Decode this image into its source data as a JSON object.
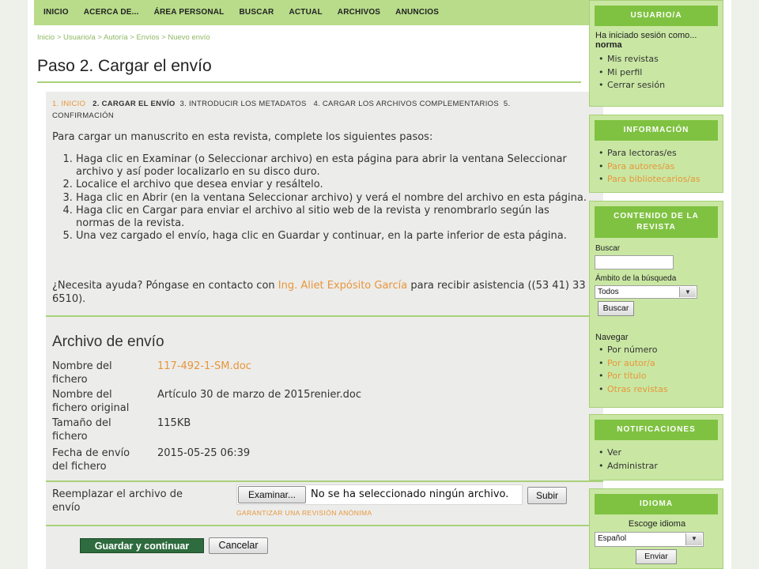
{
  "nav": [
    "INICIO",
    "ACERCA DE...",
    "ÁREA PERSONAL",
    "BUSCAR",
    "ACTUAL",
    "ARCHIVOS",
    "ANUNCIOS"
  ],
  "breadcrumb": [
    "Inicio",
    "Usuario/a",
    "Autoría",
    "Envíos",
    "Nuevo envío"
  ],
  "breadcrumb_sep": " > ",
  "page_title": "Paso 2. Cargar el envío",
  "steps": {
    "s1": "1. INICIO",
    "s2": "2. CARGAR EL ENVÍO",
    "s3": "3. INTRODUCIR LOS METADATOS",
    "s4": "4. CARGAR LOS ARCHIVOS COMPLEMENTARIOS",
    "s5": "5. CONFIRMACIÓN"
  },
  "intro": "Para cargar un manuscrito en esta revista, complete los siguientes pasos:",
  "instructions": [
    "Haga clic en Examinar (o Seleccionar archivo) en esta página para abrir la ventana Seleccionar archivo y así poder localizarlo en su disco duro.",
    "Localice el archivo que desea enviar y resáltelo.",
    "Haga clic en Abrir (en la ventana Seleccionar archivo) y verá el nombre del archivo en esta página.",
    "Haga clic en Cargar para enviar el archivo al sitio web de la revista y renombrarlo según las normas de la revista.",
    "Una vez cargado el envío, haga clic en Guardar y continuar, en la parte inferior de esta página."
  ],
  "help": {
    "before": "¿Necesita ayuda? Póngase en contacto con ",
    "contact": "Ing. Aliet Expósito García",
    "after": " para recibir asistencia ((53 41) 33 6510)."
  },
  "file_section": {
    "title": "Archivo de envío",
    "fields": [
      {
        "label": "Nombre del fichero",
        "value": "117-492-1-SM.doc"
      },
      {
        "label": "Nombre del fichero original",
        "value": "Artículo 30 de marzo de 2015renier.doc"
      },
      {
        "label": "Tamaño del fichero",
        "value": "115KB"
      },
      {
        "label": "Fecha de envío del fichero",
        "value": "2015-05-25 06:39"
      }
    ],
    "replace_label": "Reemplazar el archivo de envío",
    "browse_label": "Examinar...",
    "no_file_text": "No se ha seleccionado ningún archivo.",
    "upload_label": "Subir",
    "anon_link": "GARANTIZAR UNA REVISIÓN ANÓNIMA"
  },
  "actions": {
    "save": "Guardar y continuar",
    "cancel": "Cancelar"
  },
  "sidebar": {
    "user": {
      "title": "USUARIO/A",
      "logged_as": "Ha iniciado sesión como...",
      "username": "norma",
      "links": [
        "Mis revistas",
        "Mi perfil",
        "Cerrar sesión"
      ]
    },
    "info": {
      "title": "INFORMACIÓN",
      "links": [
        "Para lectoras/es",
        "Para autores/as",
        "Para bibliotecarios/as"
      ]
    },
    "content": {
      "title": "CONTENIDO DE LA REVISTA",
      "search_label": "Buscar",
      "scope_label": "Ámbito de la búsqueda",
      "scope_value": "Todos",
      "search_button": "Buscar",
      "browse_label": "Navegar",
      "browse_links": [
        "Por número",
        "Por autor/a",
        "Por título",
        "Otras revistas"
      ]
    },
    "notifications": {
      "title": "NOTIFICACIONES",
      "links": [
        "Ver",
        "Administrar"
      ]
    },
    "language": {
      "title": "IDIOMA",
      "choose_label": "Escoge idioma",
      "value": "Español",
      "submit": "Enviar"
    }
  },
  "colors": {
    "accent_green": "#7fc241",
    "link_orange": "#e8963a",
    "save_button": "#2e6b3e",
    "nav_bg": "#b8dc8a"
  }
}
